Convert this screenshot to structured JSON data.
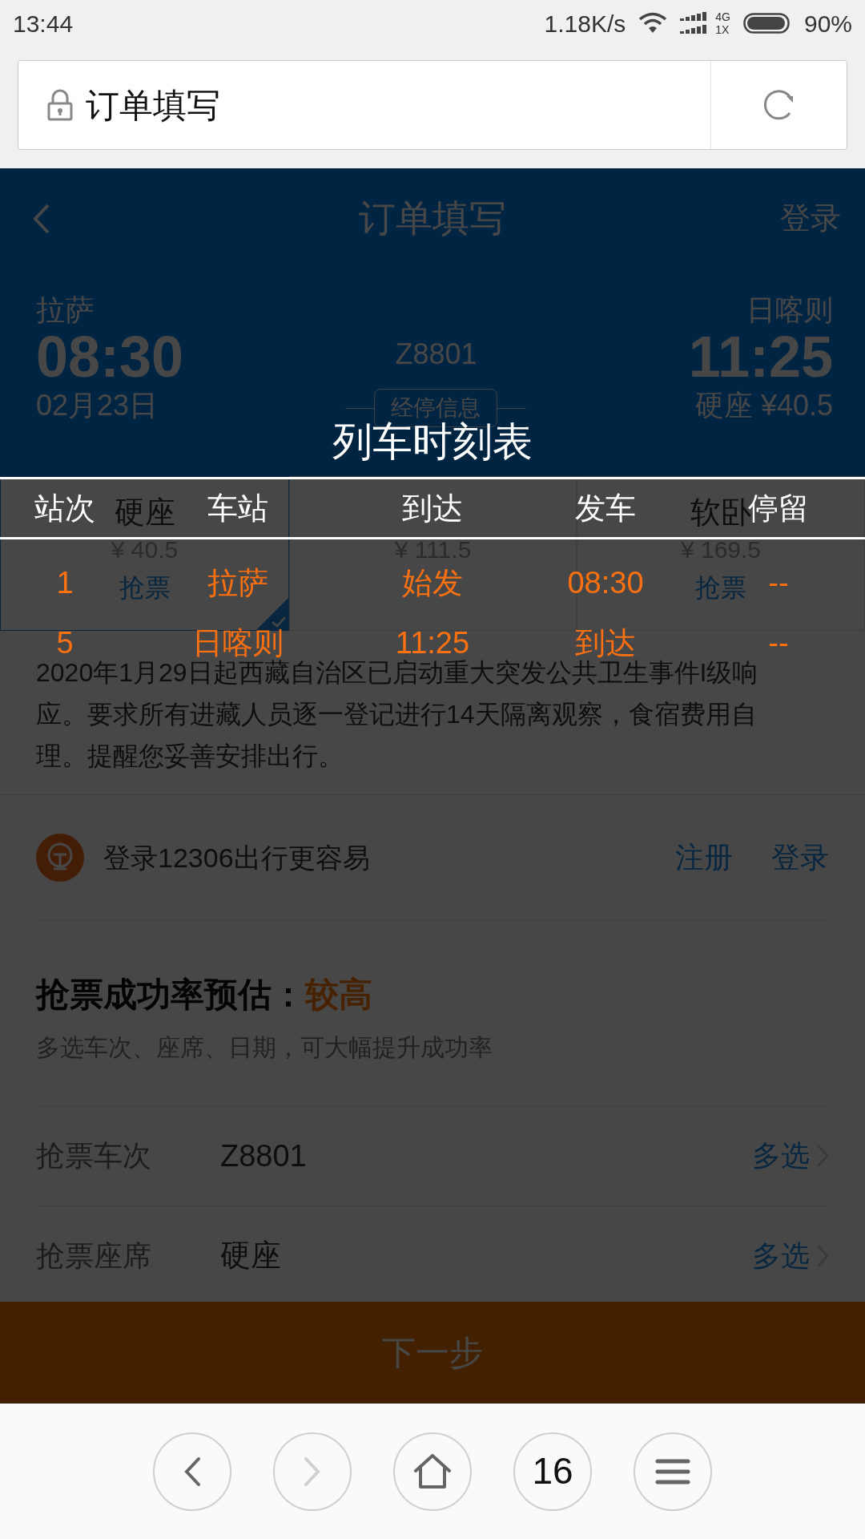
{
  "status_bar": {
    "time": "13:44",
    "speed": "1.18K/s",
    "network_top": "4G",
    "network_bottom": "1X",
    "battery": "90%"
  },
  "address_bar": {
    "title": "订单填写"
  },
  "header": {
    "title": "订单填写",
    "login": "登录"
  },
  "trip": {
    "from_station": "拉萨",
    "depart_time": "08:30",
    "depart_date": "02月23日",
    "train": "Z8801",
    "stops_button": "经停信息",
    "to_station": "日喀则",
    "arrive_time": "11:25",
    "arrive_seat_price": "硬座 ¥40.5"
  },
  "seats": [
    {
      "name": "硬座",
      "price": "¥ 40.5",
      "action": "抢票",
      "selected": true
    },
    {
      "price": "¥ 111.5",
      "selected": false
    },
    {
      "name": "软卧",
      "price": "¥ 169.5",
      "action": "抢票",
      "selected": false
    }
  ],
  "notice": "2020年1月29日起西藏自治区已启动重大突发公共卫生事件I级响应。要求所有进藏人员逐一登记进行14天隔离观察，食宿费用自理。提醒您妥善安排出行。",
  "login_prompt": {
    "text": "登录12306出行更容易",
    "register": "注册",
    "login": "登录"
  },
  "success_rate": {
    "label": "抢票成功率预估：",
    "value": "较高",
    "hint": "多选车次、座席、日期，可大幅提升成功率"
  },
  "form_rows": [
    {
      "label": "抢票车次",
      "value": "Z8801",
      "action": "多选"
    },
    {
      "label": "抢票座席",
      "value": "硬座",
      "action": "多选"
    }
  ],
  "next_button": "下一步",
  "timetable": {
    "title": "列车时刻表",
    "columns": [
      "站次",
      "车站",
      "到达",
      "发车",
      "停留"
    ],
    "rows": [
      [
        "1",
        "拉萨",
        "始发",
        "08:30",
        "--"
      ],
      [
        "5",
        "日喀则",
        "11:25",
        "到达",
        "--"
      ]
    ]
  },
  "browser_nav": {
    "tab_count": "16"
  }
}
